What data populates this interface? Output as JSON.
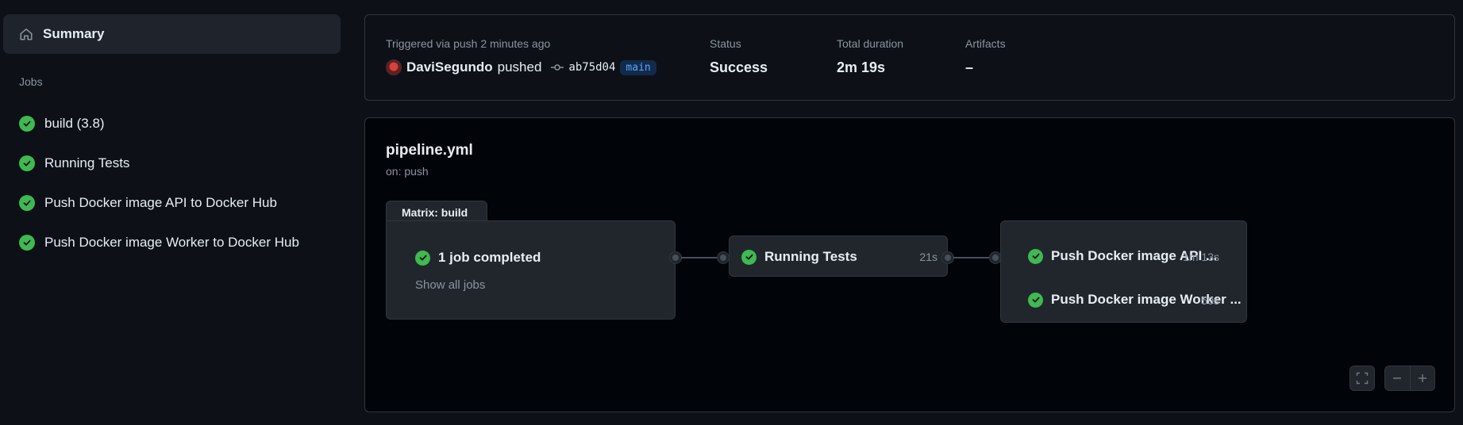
{
  "sidebar": {
    "summary": {
      "label": "Summary",
      "icon": "home-icon"
    },
    "jobs_heading": "Jobs",
    "jobs": [
      {
        "label": "build (3.8)",
        "status": "success"
      },
      {
        "label": "Running Tests",
        "status": "success"
      },
      {
        "label": "Push Docker image API to Docker Hub",
        "status": "success"
      },
      {
        "label": "Push Docker image Worker to Docker Hub",
        "status": "success"
      }
    ]
  },
  "run_summary": {
    "trigger_label": "Triggered via push 2 minutes ago",
    "user": "DaviSegundo",
    "action": "pushed",
    "commit": "ab75d04",
    "branch": "main",
    "status_label": "Status",
    "status_value": "Success",
    "duration_label": "Total duration",
    "duration_value": "2m 19s",
    "artifacts_label": "Artifacts",
    "artifacts_value": "–"
  },
  "workflow": {
    "name": "pipeline.yml",
    "trigger": "on: push",
    "matrix": {
      "tab_label": "Matrix: build",
      "summary": "1 job completed",
      "link": "Show all jobs"
    },
    "tests_job": {
      "name": "Running Tests",
      "duration": "21s"
    },
    "deploy_jobs": [
      {
        "name": "Push Docker image API ...",
        "duration": "1m 13s"
      },
      {
        "name": "Push Docker image Worker ...",
        "duration": "59s"
      }
    ]
  },
  "colors": {
    "background": "#0d1117",
    "success": "#3fb950",
    "branch_text": "#58a6ff"
  }
}
